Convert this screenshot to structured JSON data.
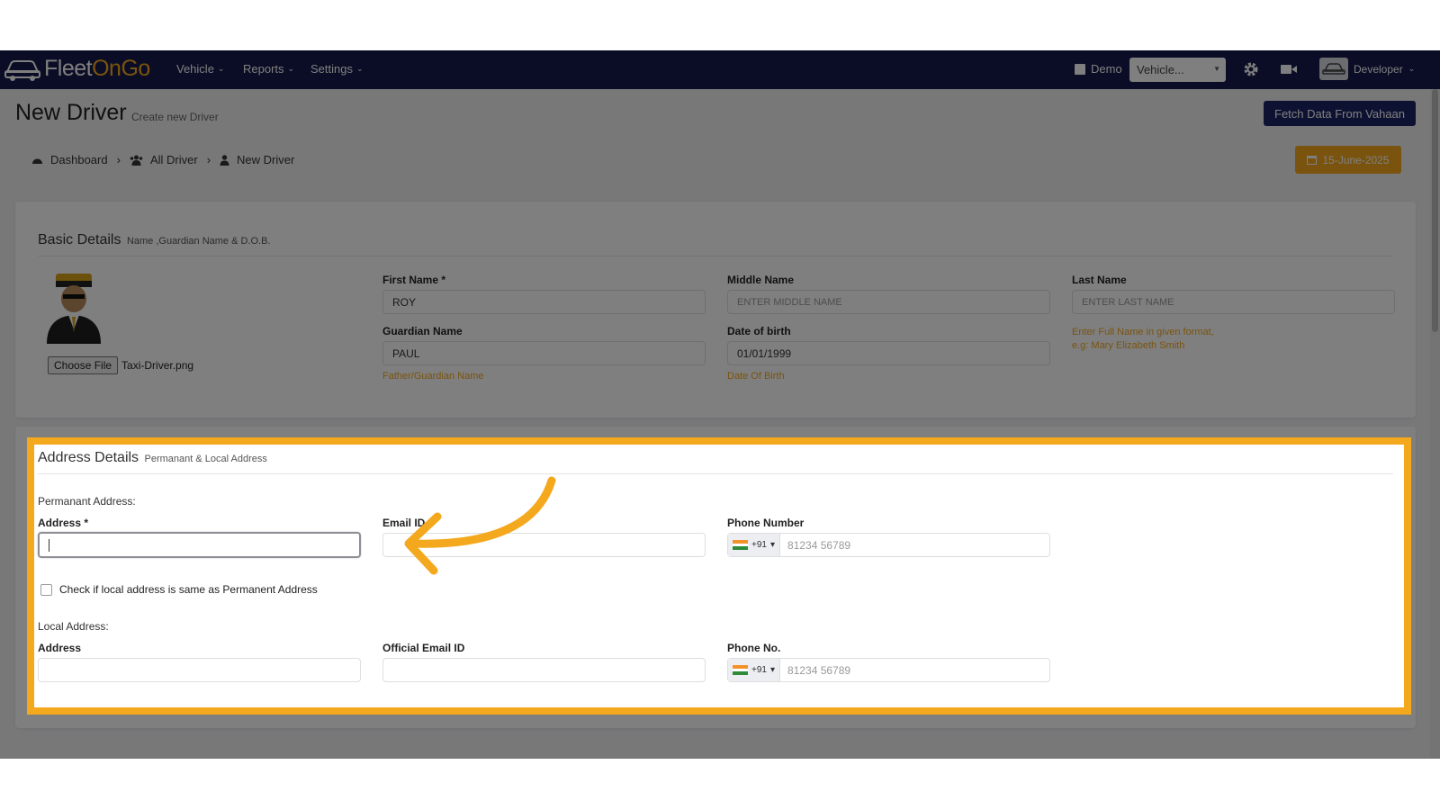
{
  "app": {
    "logo_prefix": "Fleet",
    "logo_accent": "OnGo",
    "nav": [
      {
        "label": "Vehicle"
      },
      {
        "label": "Reports"
      },
      {
        "label": "Settings"
      }
    ],
    "demo_label": "Demo",
    "vehicle_select_value": "Vehicle...",
    "user_label": "Developer",
    "icons": {
      "settings": "gear-icon",
      "video": "video-camera-icon",
      "logo": "car-icon"
    }
  },
  "page": {
    "title": "New Driver",
    "subtitle": "Create new Driver",
    "fetch_button": "Fetch Data From Vahaan",
    "date_badge": "15-June-2025"
  },
  "breadcrumb": [
    {
      "label": "Dashboard",
      "icon": "dashboard-icon"
    },
    {
      "label": "All Driver",
      "icon": "users-icon"
    },
    {
      "label": "New Driver",
      "icon": "user-icon"
    }
  ],
  "basic": {
    "title": "Basic Details",
    "subtitle": "Name ,Guardian Name & D.O.B.",
    "choose_file": "Choose File",
    "file_name": "Taxi-Driver.png",
    "first_name_label": "First Name *",
    "first_name_value": "ROY",
    "middle_name_label": "Middle Name",
    "middle_name_placeholder": "ENTER MIDDLE NAME",
    "last_name_label": "Last Name",
    "last_name_placeholder": "ENTER LAST NAME",
    "guardian_label": "Guardian Name",
    "guardian_value": "PAUL",
    "guardian_hint": "Father/Guardian Name",
    "dob_label": "Date of birth",
    "dob_value": "01/01/1999",
    "dob_hint": "Date Of Birth",
    "name_hint_1": "Enter Full Name in given format,",
    "name_hint_2": "e.g: Mary Elizabeth Smith"
  },
  "address": {
    "title": "Address Details",
    "subtitle": "Permanant & Local Address",
    "permanent_heading": "Permanant Address:",
    "address_label": "Address *",
    "email_label": "Email ID",
    "phone_label": "Phone Number",
    "country_code": "+91",
    "phone_placeholder": "81234 56789",
    "same_checkbox_label": "Check if local address is same as Permanent Address",
    "local_heading": "Local Address:",
    "local_address_label": "Address",
    "official_email_label": "Official Email ID",
    "local_phone_label": "Phone No.",
    "local_phone_placeholder": "81234 56789"
  },
  "colors": {
    "navbar": "#141a4a",
    "accent": "#f4a81d",
    "button": "#1b2564"
  }
}
